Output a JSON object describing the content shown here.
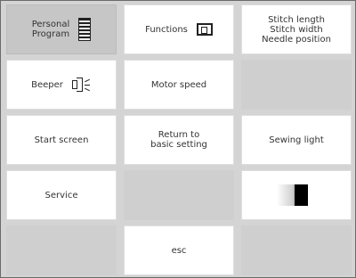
{
  "buttons": {
    "personal_program": "Personal\nProgram",
    "functions": "Functions",
    "stitch_settings": "Stitch length\nStitch width\nNeedle position",
    "beeper": "Beeper",
    "motor_speed": "Motor speed",
    "start_screen": "Start screen",
    "return_basic": "Return to\nbasic setting",
    "sewing_light": "Sewing light",
    "service": "Service",
    "esc": "esc"
  },
  "icons": {
    "personal_program": "personal-program-icon",
    "functions": "functions-icon",
    "beeper": "beeper-icon",
    "contrast": "contrast-icon"
  },
  "colors": {
    "background": "#d4d4d4",
    "button": "#ffffff",
    "pressed": "#c6c6c6"
  }
}
